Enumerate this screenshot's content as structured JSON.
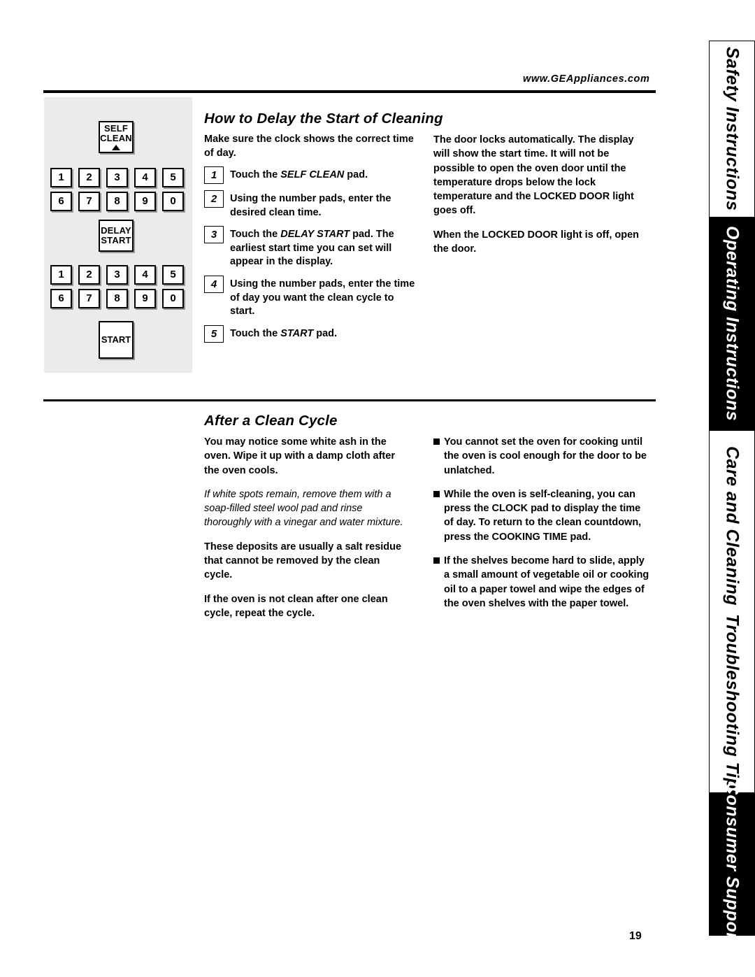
{
  "header": {
    "url": "www.GEAppliances.com",
    "page_number": "19"
  },
  "side_tabs": [
    {
      "label": "Safety Instructions",
      "style": "white"
    },
    {
      "label": "Operating Instructions",
      "style": "black"
    },
    {
      "label": "Care and Cleaning",
      "style": "white"
    },
    {
      "label": "Troubleshooting Tips",
      "style": "white"
    },
    {
      "label": "Consumer Support",
      "style": "black"
    }
  ],
  "control_panel": {
    "self_clean_line1": "SELF",
    "self_clean_line2": "CLEAN",
    "delay_start_line1": "DELAY",
    "delay_start_line2": "START",
    "start_label": "START",
    "keypad_row1": [
      "1",
      "2",
      "3",
      "4",
      "5"
    ],
    "keypad_row2": [
      "6",
      "7",
      "8",
      "9",
      "0"
    ]
  },
  "section1": {
    "heading": "How to Delay the Start of Cleaning",
    "intro": "Make sure the clock shows the correct time of day.",
    "steps": [
      {
        "num": "1",
        "pre": "Touch the ",
        "em": "SELF CLEAN",
        "post": " pad."
      },
      {
        "num": "2",
        "pre": "Using the number pads, enter the desired clean time.",
        "em": "",
        "post": ""
      },
      {
        "num": "3",
        "pre": "Touch the ",
        "em": "DELAY START",
        "post": " pad. The earliest start time you can set will appear in the display."
      },
      {
        "num": "4",
        "pre": "Using the number pads, enter the time of day you want the clean cycle to start.",
        "em": "",
        "post": ""
      },
      {
        "num": "5",
        "pre": "Touch the ",
        "em": "START",
        "post": " pad."
      }
    ],
    "right_col": [
      "The door locks automatically. The display will show the start time. It will not be possible to open the oven door until the temperature drops below the lock temperature and the LOCKED DOOR light goes off.",
      "When the LOCKED DOOR light is off, open the door."
    ]
  },
  "section2": {
    "heading": "After a Clean Cycle",
    "left_col": [
      {
        "text": "You may notice some white ash in the oven. Wipe it up with a damp cloth after the oven cools.",
        "italic": false
      },
      {
        "text": "If white spots remain, remove them with a soap-filled steel wool pad and rinse thoroughly with a vinegar and water mixture.",
        "italic": true
      },
      {
        "text": "These deposits are usually a salt residue that cannot be removed by the clean cycle.",
        "italic": false
      },
      {
        "text": "If the oven is not clean after one clean cycle, repeat the cycle.",
        "italic": false
      }
    ],
    "right_bullets": [
      "You cannot set the oven for cooking until the oven is cool enough for the door to be unlatched.",
      "While the oven is self-cleaning, you can press the CLOCK pad to display the time of day. To return to the clean countdown, press the COOKING TIME pad.",
      "If the shelves become hard to slide, apply a small amount of vegetable oil or cooking oil to a paper towel and wipe the edges of the oven shelves with the paper towel."
    ]
  }
}
